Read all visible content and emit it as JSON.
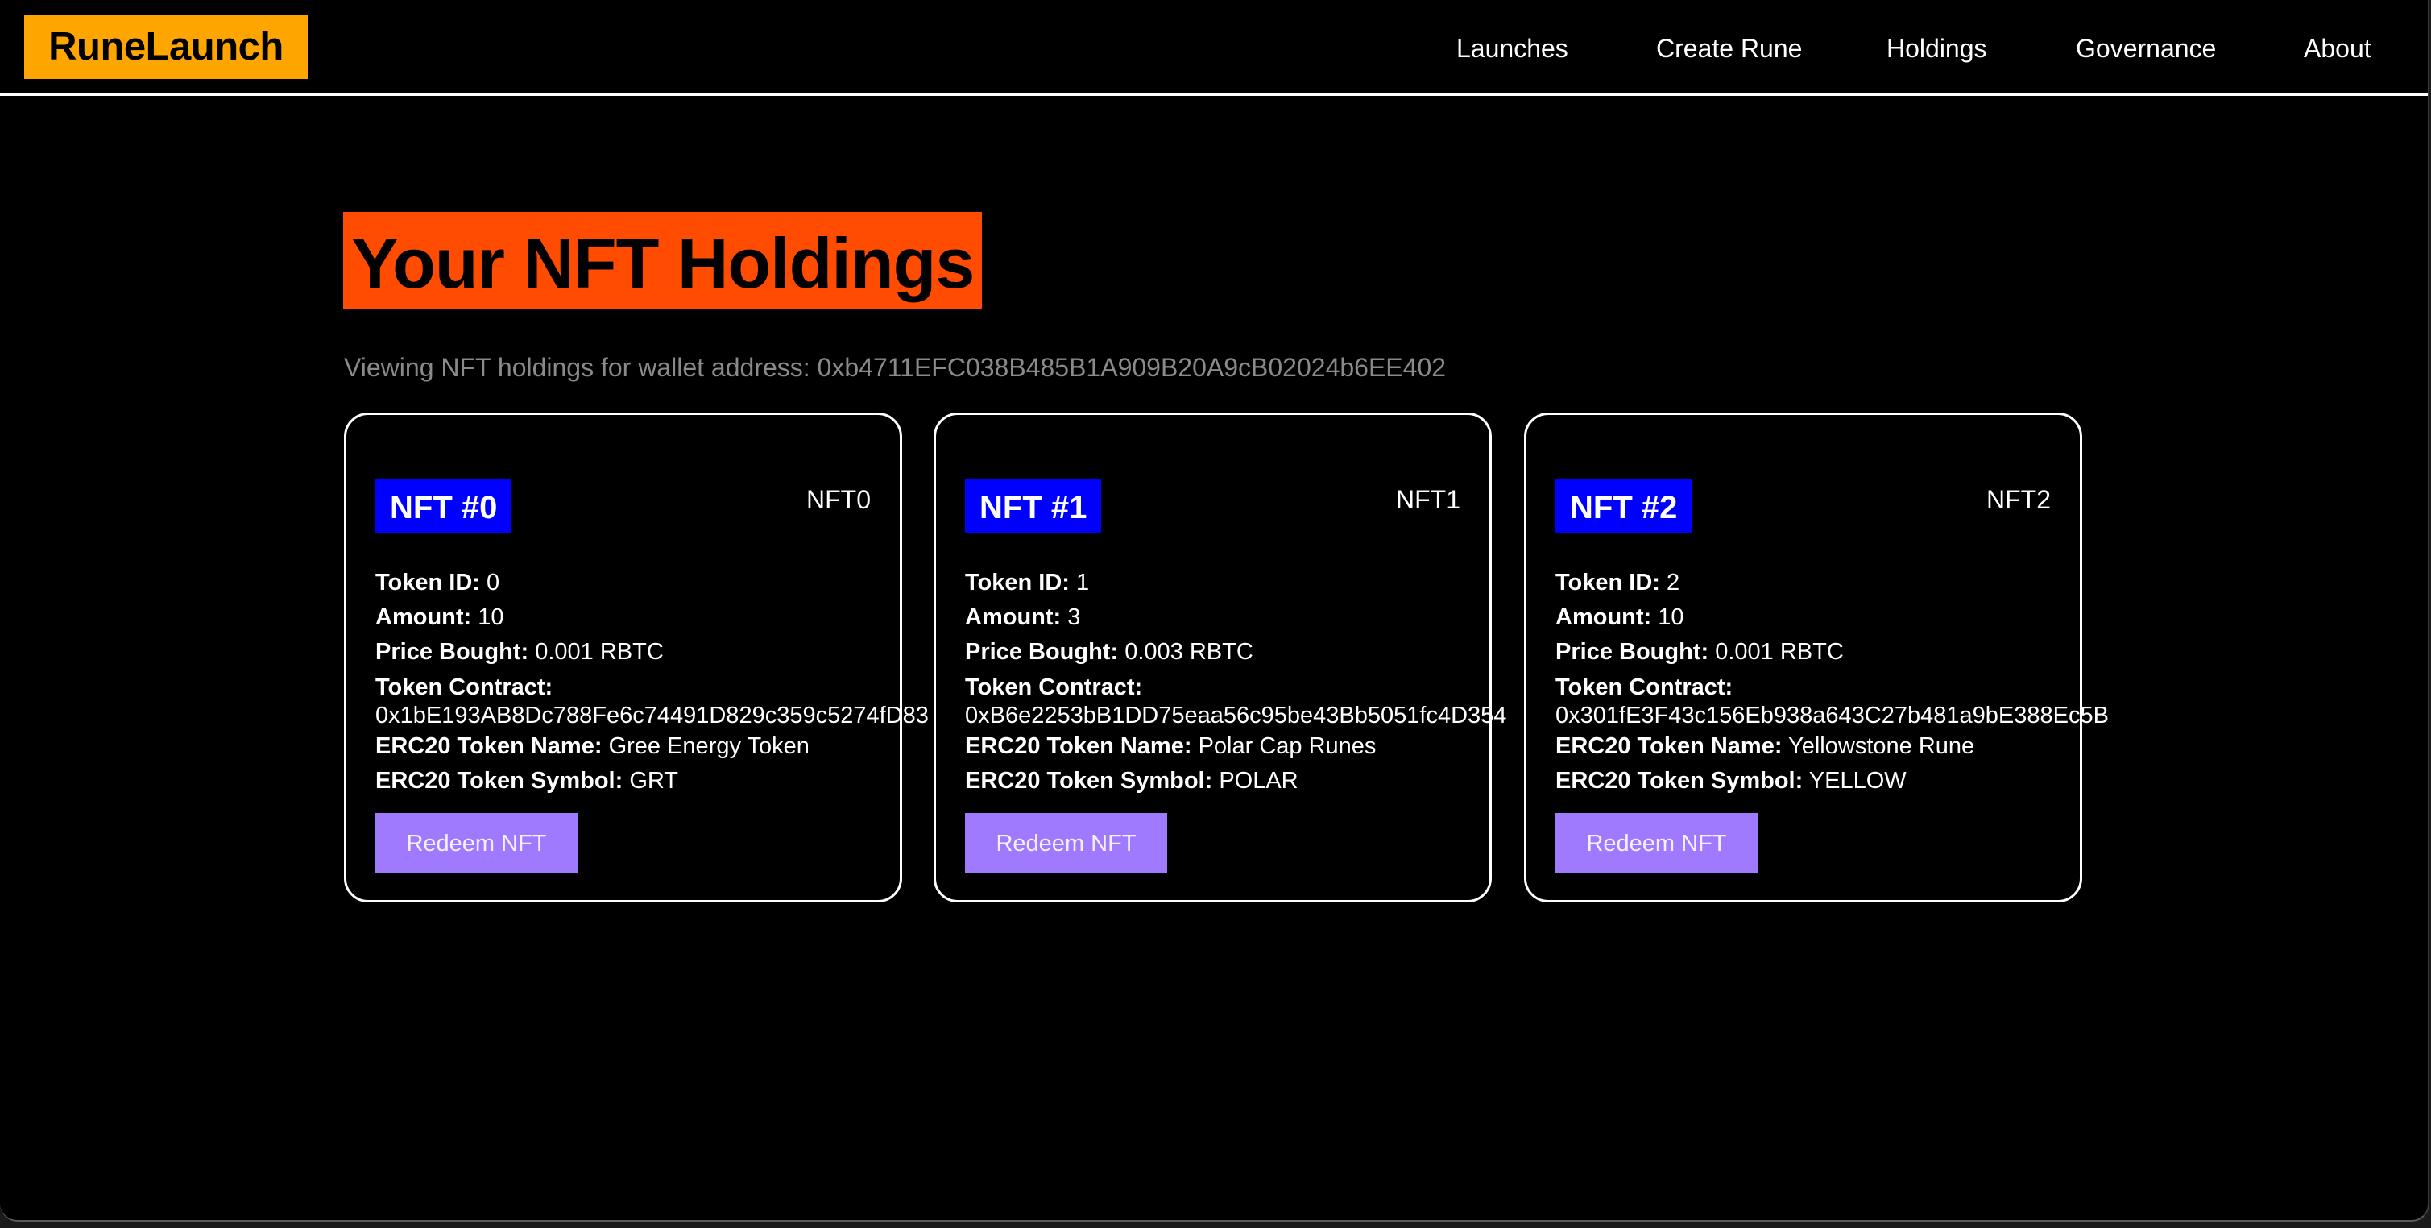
{
  "app": {
    "logo": "RuneLaunch"
  },
  "nav": {
    "items": [
      {
        "label": "Launches"
      },
      {
        "label": "Create Rune"
      },
      {
        "label": "Holdings"
      },
      {
        "label": "Governance"
      },
      {
        "label": "About"
      }
    ]
  },
  "page": {
    "title": "Your NFT Holdings",
    "subtitle": "Viewing NFT holdings for wallet address: 0xb4711EFC038B485B1A909B20A9cB02024b6EE402"
  },
  "labels": {
    "token_id": "Token ID:",
    "amount": "Amount:",
    "price_bought": "Price Bought:",
    "token_contract": "Token Contract:",
    "erc20_name": "ERC20 Token Name:",
    "erc20_symbol": "ERC20 Token Symbol:",
    "redeem_button": "Redeem NFT"
  },
  "colors": {
    "logo_bg": "#ffa500",
    "title_bg": "#ff4c00",
    "badge_bg": "#0000ff",
    "button_bg": "#9f7aff"
  },
  "nfts": [
    {
      "badge": "NFT #0",
      "name": "NFT0",
      "token_id": "0",
      "amount": "10",
      "price_bought": "0.001 RBTC",
      "token_contract": "0x1bE193AB8Dc788Fe6c74491D829c359c5274fD83",
      "erc20_name": "Gree Energy Token",
      "erc20_symbol": "GRT"
    },
    {
      "badge": "NFT #1",
      "name": "NFT1",
      "token_id": "1",
      "amount": "3",
      "price_bought": "0.003 RBTC",
      "token_contract": "0xB6e2253bB1DD75eaa56c95be43Bb5051fc4D354",
      "erc20_name": "Polar Cap Runes",
      "erc20_symbol": "POLAR"
    },
    {
      "badge": "NFT #2",
      "name": "NFT2",
      "token_id": "2",
      "amount": "10",
      "price_bought": "0.001 RBTC",
      "token_contract": "0x301fE3F43c156Eb938a643C27b481a9bE388Ec5B",
      "erc20_name": "Yellowstone Rune",
      "erc20_symbol": "YELLOW"
    }
  ]
}
